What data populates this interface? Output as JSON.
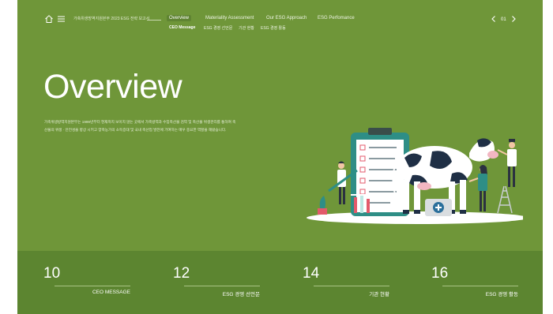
{
  "header": {
    "doc_title": "가축위생방역지원본부 2023 ESG 전략 보고서",
    "nav": [
      "Overview",
      "Materiality Assessment",
      "Our ESG Approach",
      "ESG Perfomance"
    ],
    "subnav": [
      "CEO Message",
      "ESG 경영 선언문",
      "기관 현황",
      "ESG 경영 활동"
    ],
    "page_number": "01"
  },
  "hero": {
    "title": "Overview",
    "description": "가축위생방역지원본부는 1999년부터 현재까지 보이지 않는 곳에서 가축방역과 수입축산물 검역 및 축산물 위생관리를 통하여 축산물의 위생 · 안전성을 향상 시키고 양축농가의 소득증대 및 국내 축산업 발전에 기여하는 매우 중요한 역할을 해왔습니다."
  },
  "cards": [
    {
      "number": "10",
      "label": "CEO MESSAGE"
    },
    {
      "number": "12",
      "label": "ESG 경영 선언문"
    },
    {
      "number": "14",
      "label": "기관 현황"
    },
    {
      "number": "16",
      "label": "ESG 경영 활동"
    }
  ],
  "colors": {
    "background": "#6f9639",
    "footer": "#5c8530",
    "clipboard": "#2e8e86"
  },
  "icons": [
    "home-icon",
    "menu-icon",
    "chevron-left-icon",
    "chevron-right-icon"
  ]
}
